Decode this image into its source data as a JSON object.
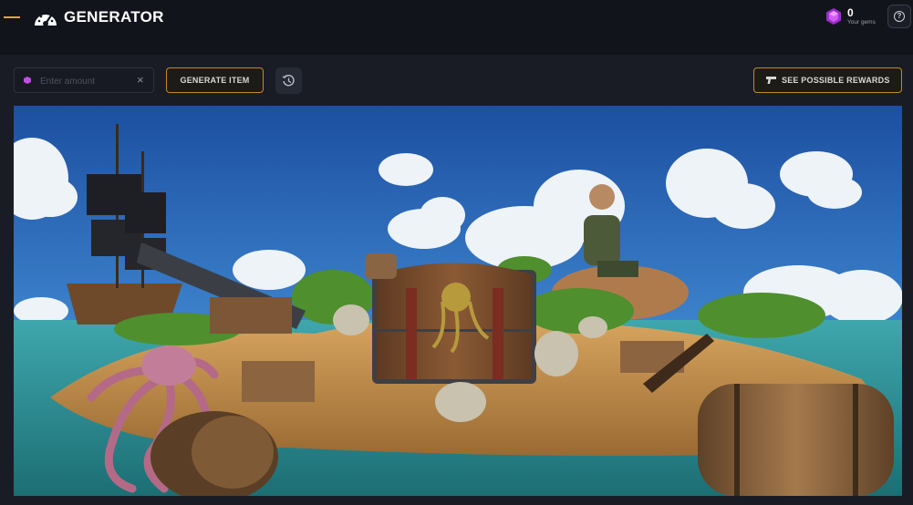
{
  "header": {
    "title": "GENERATOR",
    "gems_count": "0",
    "gems_label": "Your gems",
    "help_symbol": "?"
  },
  "controls": {
    "amount_placeholder": "Enter amount",
    "amount_value": "",
    "clear_symbol": "×",
    "generate_label": "GENERATE ITEM",
    "rewards_label": "SEE POSSIBLE REWARDS"
  },
  "icons": {
    "logo": "speedometer-icon",
    "gem": "purple-gem-icon",
    "help": "question-circle-icon",
    "history": "history-icon",
    "rewards": "pistol-icon"
  },
  "colors": {
    "accent": "#c28a24",
    "gem": "#b23ddb",
    "background": "#12141b",
    "panel": "#191c25"
  }
}
